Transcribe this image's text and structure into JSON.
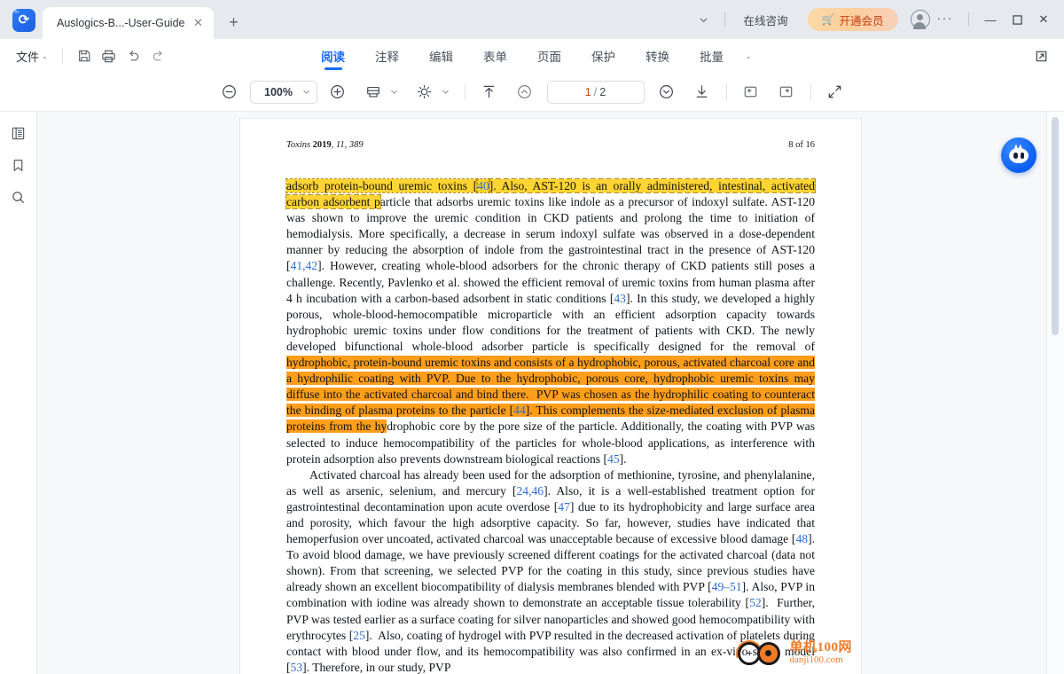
{
  "window": {
    "tab": {
      "title": "Auslogics-B...-User-Guide",
      "close_label": "✕"
    },
    "new_tab_label": "+",
    "tab_list_chevron": "⌄",
    "consult_label": "在线咨询",
    "vip_label": "开通会员",
    "more_label": "···",
    "minimize_label": "—",
    "maximize_label": "☐",
    "close_label": "✕",
    "accent_blue": "#1a6dff",
    "vip_text_color": "#c2410c"
  },
  "menubar": {
    "file_label": "文件",
    "file_caret": "⌄",
    "icons": [
      "save-icon",
      "print-icon",
      "undo-icon",
      "redo-icon"
    ],
    "tabs": [
      {
        "label": "阅读",
        "active": true
      },
      {
        "label": "注释",
        "active": false
      },
      {
        "label": "编辑",
        "active": false
      },
      {
        "label": "表单",
        "active": false
      },
      {
        "label": "页面",
        "active": false
      },
      {
        "label": "保护",
        "active": false
      },
      {
        "label": "转换",
        "active": false
      },
      {
        "label": "批量",
        "active": false
      }
    ],
    "overflow_caret": "⌄",
    "external_link_icon": "external-link-icon"
  },
  "toolbar": {
    "zoom_out_label": "⊖",
    "zoom_value": "100%",
    "zoom_caret": "⌄",
    "zoom_in_label": "⊕",
    "page_layout_icon": "page-layout-icon",
    "brightness_icon": "brightness-icon",
    "scroll_top_icon": "scroll-to-top-icon",
    "page_up_icon": "page-up-icon",
    "page_current": "1",
    "page_separator": "/",
    "page_total": "2",
    "page_down_icon": "page-down-icon",
    "download_icon": "download-icon",
    "prev_view_icon": "previous-view-icon",
    "next_view_icon": "next-view-icon",
    "fullscreen_icon": "fullscreen-icon"
  },
  "sidebar": {
    "items": [
      {
        "name": "thumbnails-icon"
      },
      {
        "name": "bookmark-icon"
      },
      {
        "name": "search-icon"
      }
    ]
  },
  "document": {
    "header_left_italic": "Toxins ",
    "header_left_bold": "2019",
    "header_left_rest": ", 11, 389",
    "header_right": "8 of 16",
    "paragraphs": [
      {
        "id": "p1",
        "indent": false,
        "runs": [
          {
            "t": "adsorb protein-bound uremic toxins [",
            "hl": "yellow"
          },
          {
            "t": "40",
            "hl": "yellow",
            "ref": true
          },
          {
            "t": "]. Also, AST-120 is an orally administered, intestinal, activated carbon adsorbent p",
            "hl": "yellow"
          },
          {
            "t": "article that adsorbs uremic toxins like indole as a precursor of indoxyl sulfate. AST-120 was shown to improve the uremic condition in CKD patients and prolong the time to initiation of hemodialysis. More specifically, a decrease in serum indoxyl sulfate was observed in a dose-dependent manner by reducing the absorption of indole from the gastrointestinal tract in the presence of AST-120 ["
          },
          {
            "t": "41,42",
            "ref": true
          },
          {
            "t": "]. However, creating whole-blood adsorbers for the chronic therapy of CKD patients still poses a challenge. Recently, Pavlenko et al. showed the efficient removal of uremic toxins from human plasma after 4 h incubation with a carbon-based adsorbent in static conditions ["
          },
          {
            "t": "43",
            "ref": true
          },
          {
            "t": "]. In this study, we developed a highly porous, whole-blood-hemocompatible microparticle with an efficient adsorption capacity towards hydrophobic uremic toxins under flow conditions for the treatment of patients with CKD. The newly developed bifunctional whole-blood adsorber particle is specifically designed for the removal of "
          },
          {
            "t": "hydrophobic, protein-bound uremic toxins and consists of a hydrophobic, porous, activated charcoal core and a hydrophilic coating with PVP. Due to the hydrophobic, porous core, hydrophobic uremic toxins may diffuse into the activated charcoal and bind there.  PVP was chosen as the hydrophilic coating to counteract the binding of plasma proteins to the particle [",
            "hl": "orange"
          },
          {
            "t": "44",
            "hl": "orange",
            "ref": true
          },
          {
            "t": "]. This complements the size-mediated exclusion of plasma proteins from the hy",
            "hl": "orange"
          },
          {
            "t": "drophobic core by the pore size of the particle. Additionally, the coating with PVP was selected to induce hemocompatibility of the particles for whole-blood applications, as interference with protein adsorption also prevents downstream biological reactions ["
          },
          {
            "t": "45",
            "ref": true
          },
          {
            "t": "]."
          }
        ]
      },
      {
        "id": "p2",
        "indent": true,
        "runs": [
          {
            "t": "Activated charcoal has already been used for the adsorption of methionine, tyrosine, and phenylalanine, as well as arsenic, selenium, and mercury ["
          },
          {
            "t": "24,46",
            "ref": true
          },
          {
            "t": "]. Also, it is a well-established treatment option for gastrointestinal decontamination upon acute overdose ["
          },
          {
            "t": "47",
            "ref": true
          },
          {
            "t": "] due to its hydrophobicity and large surface area and porosity, which favour the high adsorptive capacity. So far, however, studies have indicated that hemoperfusion over uncoated, activated charcoal was unacceptable because of excessive blood damage ["
          },
          {
            "t": "48",
            "ref": true
          },
          {
            "t": "]. To avoid blood damage, we have previously screened different coatings for the activated charcoal (data not shown). From that screening, we selected PVP for the coating in this study, since previous studies have already shown an excellent biocompatibility of dialysis membranes blended with PVP ["
          },
          {
            "t": "49–51",
            "ref": true
          },
          {
            "t": "]. Also, PVP in combination with iodine was already shown to demonstrate an acceptable tissue tolerability ["
          },
          {
            "t": "52",
            "ref": true
          },
          {
            "t": "].  Further, PVP was tested earlier as a surface coating for silver nanoparticles and showed good hemocompatibility with erythrocytes ["
          },
          {
            "t": "25",
            "ref": true
          },
          {
            "t": "].  Also, coating of hydrogel with PVP resulted in the decreased activation of platelets during contact with blood under flow, and its hemocompatibility was also confirmed in an ex-vivo sheep model ["
          },
          {
            "t": "53",
            "ref": true
          },
          {
            "t": "]. Therefore, in our study, PVP"
          }
        ]
      }
    ],
    "highlight_yellow_color": "#ffd433",
    "highlight_orange_color": "#ff9e1b",
    "reference_link_color": "#2f6fd0"
  },
  "ai_assistant": {
    "name": "ai-assistant-button"
  },
  "watermark": {
    "cn": "单机100网",
    "en": "danji100.com",
    "color": "#f07b27"
  }
}
